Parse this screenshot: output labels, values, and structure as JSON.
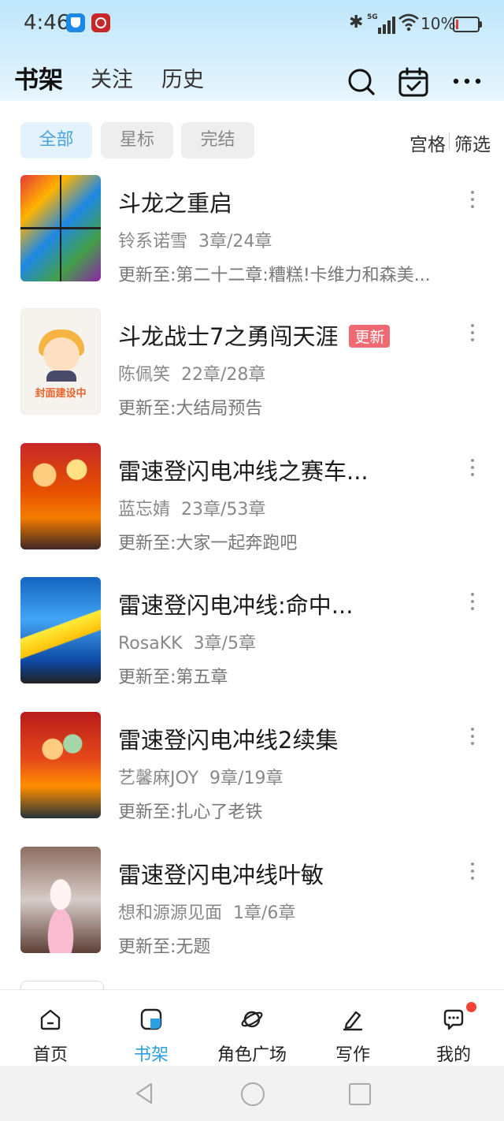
{
  "status_bar": {
    "time": "4:46",
    "signal_label": "5G",
    "battery_pct": "10%",
    "battery_level": 0.1
  },
  "top_nav": {
    "tabs": [
      "书架",
      "关注",
      "历史"
    ],
    "active_tab": "书架"
  },
  "filters": {
    "chips": [
      "全部",
      "星标",
      "完结"
    ],
    "active_chip": "全部",
    "grid_label": "宫格",
    "filter_label": "筛选"
  },
  "books": [
    {
      "title": "斗龙之重启",
      "badge": "",
      "author": "铃系诺雪",
      "progress": "3章/24章",
      "update_prefix": "更新至:",
      "update": "第二十二章:糟糕!卡维力和森美..."
    },
    {
      "title": "斗龙战士7之勇闯天涯",
      "badge": "更新",
      "author": "陈佩笑",
      "progress": "22章/28章",
      "update_prefix": "更新至:",
      "update": "大结局预告",
      "cover_label": "封面建设中"
    },
    {
      "title": "雷速登闪电冲线之赛车...",
      "badge": "",
      "author": "蓝忘婧",
      "progress": "23章/53章",
      "update_prefix": "更新至:",
      "update": "大家一起奔跑吧"
    },
    {
      "title": "雷速登闪电冲线:命中...",
      "badge": "",
      "author": "RosaKK",
      "progress": "3章/5章",
      "update_prefix": "更新至:",
      "update": "第五章"
    },
    {
      "title": "雷速登闪电冲线2续集",
      "badge": "",
      "author": "艺馨麻JOY",
      "progress": "9章/19章",
      "update_prefix": "更新至:",
      "update": "扎心了老铁"
    },
    {
      "title": "雷速登闪电冲线叶敏",
      "badge": "",
      "author": "想和源源见面",
      "progress": "1章/6章",
      "update_prefix": "更新至:",
      "update": "无题"
    }
  ],
  "bottom_nav": {
    "items": [
      {
        "label": "首页",
        "icon": "home-icon"
      },
      {
        "label": "书架",
        "icon": "bookshelf-icon"
      },
      {
        "label": "角色广场",
        "icon": "planet-icon"
      },
      {
        "label": "写作",
        "icon": "pen-icon"
      },
      {
        "label": "我的",
        "icon": "chat-icon"
      }
    ],
    "active": "书架",
    "notification_dot_on": "我的"
  },
  "colors": {
    "accent": "#2d9ee0",
    "chip_active_bg": "#e3f2fd",
    "badge": "#f06a73",
    "notification": "#f44336",
    "header_gradient_top": "#bfe6fb"
  }
}
